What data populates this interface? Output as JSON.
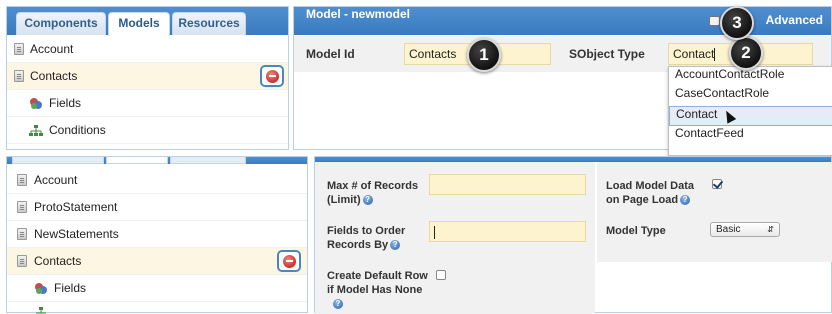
{
  "top_left": {
    "tabs": [
      {
        "label": "Components"
      },
      {
        "label": "Models"
      },
      {
        "label": "Resources"
      }
    ],
    "items": [
      {
        "label": "Account"
      },
      {
        "label": "Contacts"
      },
      {
        "label": "Fields"
      },
      {
        "label": "Conditions"
      }
    ]
  },
  "model_panel": {
    "title": "Model - newmodel",
    "advanced_label": "Advanced",
    "model_id_label": "Model Id",
    "model_id_value": "Contacts",
    "sobject_label": "SObject Type",
    "sobject_value": "Contact",
    "dropdown_options": [
      "AccountContactRole",
      "CaseContactRole",
      "Contact",
      "ContactFeed"
    ],
    "highlighted_option": "Contact"
  },
  "callouts": [
    "1",
    "2",
    "3"
  ],
  "bottom_left": {
    "items": [
      {
        "label": "Account"
      },
      {
        "label": "ProtoStatement"
      },
      {
        "label": "NewStatements"
      },
      {
        "label": "Contacts"
      },
      {
        "label": "Fields"
      }
    ]
  },
  "bottom_right": {
    "max_records_label_1": "Max # of Records",
    "max_records_label_2": "(Limit)",
    "fields_order_label_1": "Fields to Order",
    "fields_order_label_2": "Records By",
    "create_default_label_1": "Create Default Row",
    "create_default_label_2": "if Model Has None",
    "load_model_label_1": "Load Model Data",
    "load_model_label_2": "on Page Load",
    "load_model_checked": true,
    "model_type_label": "Model Type",
    "model_type_value": "Basic",
    "help_glyph": "?"
  }
}
